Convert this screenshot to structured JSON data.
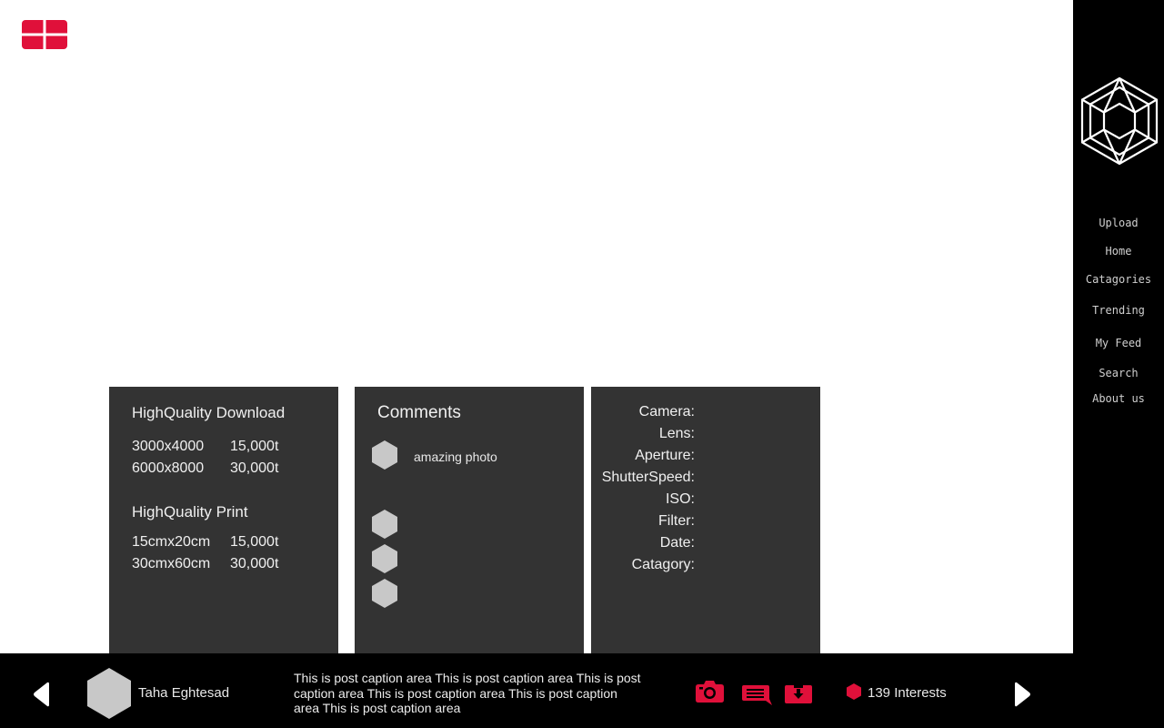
{
  "colors": {
    "accent": "#e0103a",
    "panel": "#333333",
    "bar": "#000000",
    "avatar": "#c8c8c8"
  },
  "header": {
    "menu_icon": "grid-icon"
  },
  "sidebar": {
    "logo_icon": "hexagon-logo-icon",
    "items": [
      {
        "label": "Upload"
      },
      {
        "label": "Home"
      },
      {
        "label": "Catagories"
      },
      {
        "label": "Trending"
      },
      {
        "label": "My Feed"
      },
      {
        "label": "Search"
      },
      {
        "label": "About us"
      }
    ]
  },
  "download": {
    "title": "HighQuality Download",
    "options": [
      {
        "size": "3000x4000",
        "price": "15,000t"
      },
      {
        "size": "6000x8000",
        "price": "30,000t"
      }
    ]
  },
  "print": {
    "title": "HighQuality Print",
    "options": [
      {
        "size": "15cmx20cm",
        "price": "15,000t"
      },
      {
        "size": "30cmx60cm",
        "price": "30,000t"
      }
    ]
  },
  "comments": {
    "title": "Comments",
    "items": [
      {
        "text": "amazing photo"
      },
      {
        "text": ""
      },
      {
        "text": ""
      },
      {
        "text": ""
      }
    ]
  },
  "specs": {
    "labels": [
      "Camera:",
      "Lens:",
      "Aperture:",
      "ShutterSpeed:",
      "ISO:",
      "Filter:",
      "Date:",
      "Catagory:"
    ]
  },
  "footer": {
    "username": "Taha Eghtesad",
    "caption": "This is post caption area This is post caption area This is post caption area This is post caption area This is post caption area This is post caption area",
    "actions": [
      "camera-icon",
      "comment-icon",
      "download-icon"
    ],
    "interests_label": "139 Interests"
  }
}
